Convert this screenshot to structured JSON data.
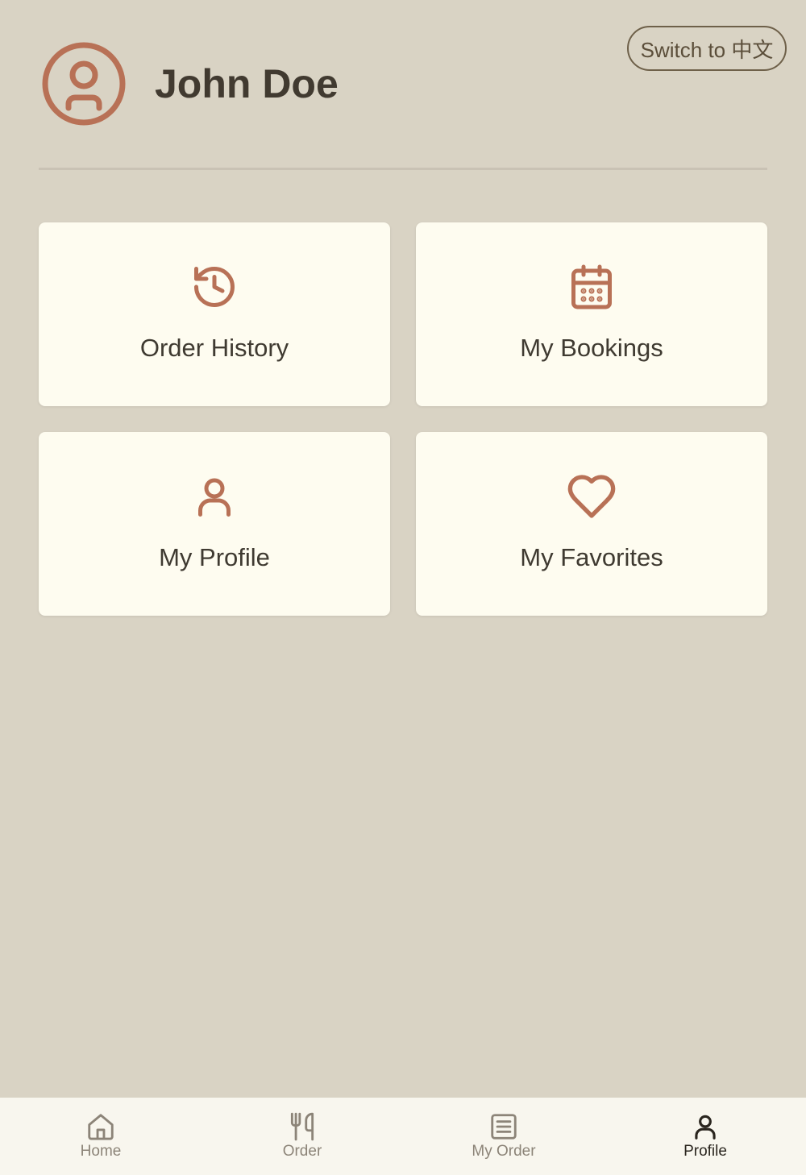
{
  "language_switch": {
    "label": "Switch to 中文"
  },
  "user": {
    "name": "John Doe",
    "avatar_icon": "user-circle-icon"
  },
  "accent_color": "#b87156",
  "cards": [
    {
      "label": "Order History",
      "icon": "history-icon"
    },
    {
      "label": "My Bookings",
      "icon": "calendar-icon"
    },
    {
      "label": "My Profile",
      "icon": "user-icon"
    },
    {
      "label": "My Favorites",
      "icon": "heart-icon"
    }
  ],
  "bottom_nav": {
    "items": [
      {
        "label": "Home",
        "icon": "home-icon",
        "active": false
      },
      {
        "label": "Order",
        "icon": "utensils-icon",
        "active": false
      },
      {
        "label": "My Order",
        "icon": "list-icon",
        "active": false
      },
      {
        "label": "Profile",
        "icon": "user-icon",
        "active": true
      }
    ]
  }
}
